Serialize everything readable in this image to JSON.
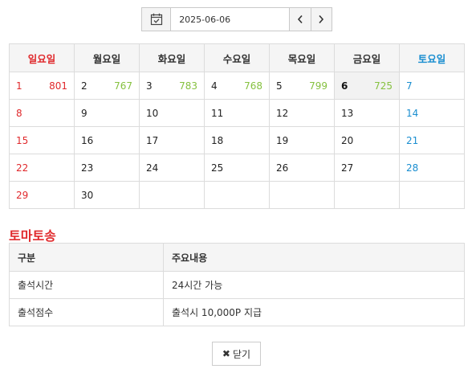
{
  "datepicker": {
    "value": "2025-06-06",
    "prev": "‹",
    "next": "›"
  },
  "calendar": {
    "weekdays": [
      "일요일",
      "월요일",
      "화요일",
      "수요일",
      "목요일",
      "금요일",
      "토요일"
    ],
    "week1": [
      {
        "day": "1",
        "count": "801"
      },
      {
        "day": "2",
        "count": "767"
      },
      {
        "day": "3",
        "count": "783"
      },
      {
        "day": "4",
        "count": "768"
      },
      {
        "day": "5",
        "count": "799"
      },
      {
        "day": "6",
        "count": "725"
      },
      {
        "day": "7",
        "count": ""
      }
    ],
    "week2": [
      "8",
      "9",
      "10",
      "11",
      "12",
      "13",
      "14"
    ],
    "week3": [
      "15",
      "16",
      "17",
      "18",
      "19",
      "20",
      "21"
    ],
    "week4": [
      "22",
      "23",
      "24",
      "25",
      "26",
      "27",
      "28"
    ],
    "week5": [
      "29",
      "30",
      "",
      "",
      "",
      "",
      ""
    ],
    "today": "6",
    "colors": {
      "sunday": "#e0292c",
      "saturday": "#1a8ed0",
      "count": "#85c13f"
    }
  },
  "section_title": "토마토송",
  "info_table": {
    "headers": [
      "구분",
      "주요내용"
    ],
    "rows": [
      [
        "출석시간",
        "24시간 가능"
      ],
      [
        "출석점수",
        "출석시 10,000P 지급"
      ]
    ]
  },
  "close_button": {
    "icon": "x-icon",
    "label": "닫기"
  }
}
